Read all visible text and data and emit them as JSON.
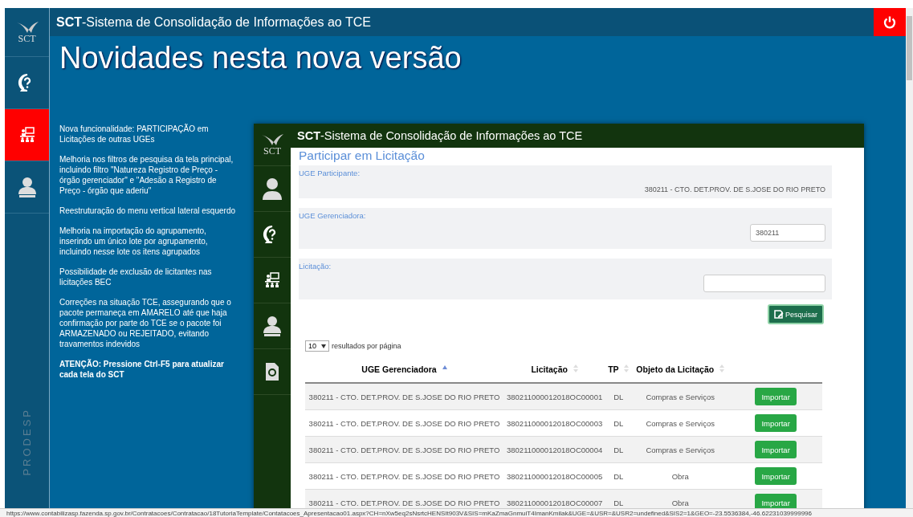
{
  "app_title": {
    "brand": "SCT",
    "rest": "-Sistema de Consolidação de Informações ao TCE"
  },
  "logo_text": "SCT",
  "sidebar": {
    "items": [
      {
        "kind": "help",
        "selected": false
      },
      {
        "kind": "training",
        "selected": true
      },
      {
        "kind": "audesp",
        "selected": false
      }
    ],
    "footer": "PRODESP"
  },
  "heading": "Novidades nesta nova versão",
  "notes": [
    {
      "text": "Nova funcionalidade: PARTICIPAÇÃO em Licitações de outras UGEs",
      "bold": false
    },
    {
      "text": "Melhoria nos filtros de pesquisa da tela principal, incluindo filtro \"Natureza Registro de Preço - órgão gerenciador\" e \"Adesão a Registro de Preço - órgão que aderiu\"",
      "bold": false
    },
    {
      "text": "Reestruturação do menu vertical lateral esquerdo",
      "bold": false
    },
    {
      "text": "Melhoria na importação do agrupamento, inserindo um único lote por agrupamento, incluindo nesse lote os itens agrupados",
      "bold": false
    },
    {
      "text": "Possibilidade de exclusão de licitantes nas licitações BEC",
      "bold": false
    },
    {
      "text": "Correções na situação TCE, assegurando que o pacote permaneça em AMARELO até que haja confirmação por parte do TCE se o pacote foi ARMAZENADO ou REJEITADO, evitando travamentos indevidos",
      "bold": false
    },
    {
      "text": "ATENÇÃO: Pressione Ctrl-F5 para atualizar cada tela do SCT",
      "bold": true
    }
  ],
  "inner_window": {
    "title": {
      "brand": "SCT",
      "rest": "-Sistema de Consolidação de Informações ao TCE"
    },
    "logo_text": "SCT",
    "sidebar_items": [
      {
        "kind": "user"
      },
      {
        "kind": "help"
      },
      {
        "kind": "training"
      },
      {
        "kind": "audesp"
      },
      {
        "kind": "document"
      }
    ],
    "page_title": "Participar em Licitação",
    "fields": [
      {
        "kind": "text",
        "label": "UGE Participante:",
        "value": "380211 - CTO. DET.PROV. DE S.JOSE DO RIO PRETO"
      },
      {
        "kind": "input",
        "label": "UGE Gerenciadora:",
        "value": "380211"
      },
      {
        "kind": "wide_input",
        "label": "Licitação:"
      }
    ],
    "search_button": "Pesquisar",
    "page_size": {
      "value": "10",
      "label": "resultados por página"
    },
    "table": {
      "columns": [
        {
          "label": "UGE Gerenciadora",
          "sorted": true
        },
        {
          "label": "Licitação",
          "sorted": false
        },
        {
          "label": "TP",
          "sorted": false
        },
        {
          "label": "Objeto da Licitação",
          "sorted": false
        }
      ],
      "rows": [
        {
          "uge": "380211 - CTO. DET.PROV. DE S.JOSE DO RIO PRETO",
          "licitacao": "380211000012018OC00001",
          "tp": "DL",
          "objeto": "Compras e Serviços",
          "action": "Importar"
        },
        {
          "uge": "380211 - CTO. DET.PROV. DE S.JOSE DO RIO PRETO",
          "licitacao": "380211000012018OC00003",
          "tp": "DL",
          "objeto": "Compras e Serviços",
          "action": "Importar"
        },
        {
          "uge": "380211 - CTO. DET.PROV. DE S.JOSE DO RIO PRETO",
          "licitacao": "380211000012018OC00004",
          "tp": "DL",
          "objeto": "Compras e Serviços",
          "action": "Importar"
        },
        {
          "uge": "380211 - CTO. DET.PROV. DE S.JOSE DO RIO PRETO",
          "licitacao": "380211000012018OC00005",
          "tp": "DL",
          "objeto": "Obra",
          "action": "Importar"
        },
        {
          "uge": "380211 - CTO. DET.PROV. DE S.JOSE DO RIO PRETO",
          "licitacao": "380211000012018OC00007",
          "tp": "DL",
          "objeto": "Obra",
          "action": "Importar"
        }
      ]
    }
  },
  "status_bar": {
    "url": "https://www.contabilizasp.fazenda.sp.gov.br/Contratacoes/Contratacao/18TutoriaTemplate/Contatacoes_Apresentacao01.aspx?CH=nXw5eq2sNsrtcHENSIt903V&SIS=mKaZmaGnmuiT4ImanKmilak&UGE=&USR=&USR2=undefined&SIS2=1&GEO=-23.5536384,-46.62231039999996"
  }
}
